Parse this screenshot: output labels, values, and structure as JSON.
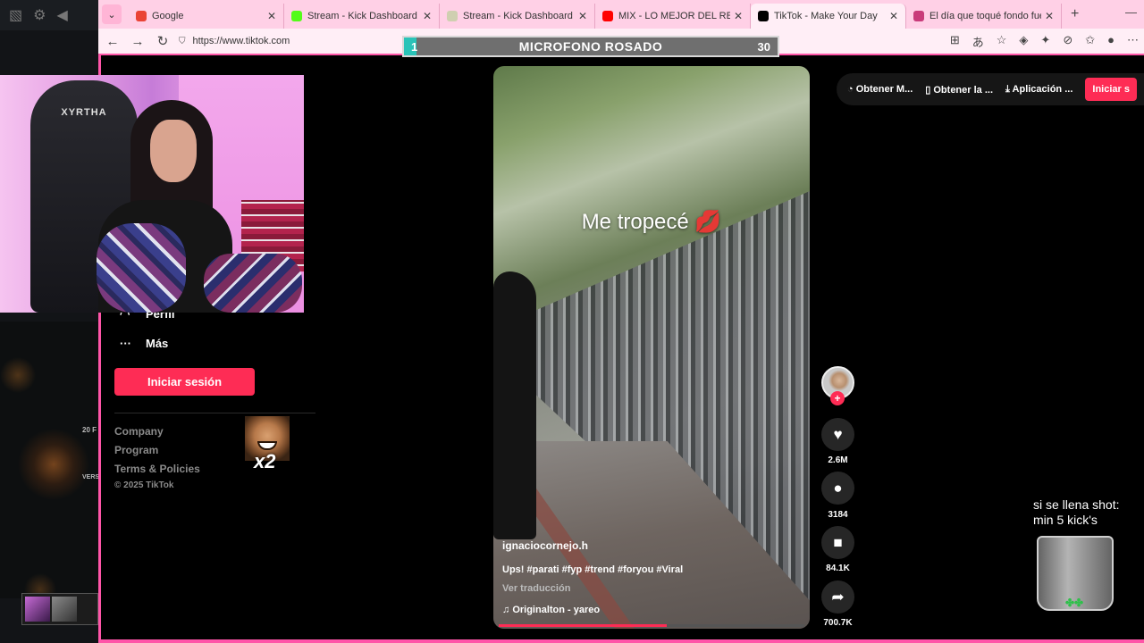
{
  "browser": {
    "tabs": [
      {
        "title": "Google",
        "favicon_color": "#ea4335",
        "active": false
      },
      {
        "title": "Stream - Kick Dashboard",
        "favicon_color": "#53fc18",
        "active": false
      },
      {
        "title": "Stream - Kick Dashboard",
        "favicon_color": "#cfcfb0",
        "active": false
      },
      {
        "title": "MIX - LO MEJOR DEL REGG",
        "favicon_color": "#ff0000",
        "active": false
      },
      {
        "title": "TikTok - Make Your Day",
        "favicon_color": "#000000",
        "active": true
      },
      {
        "title": "El día que toqué fondo fue el d",
        "favicon_color": "#c93b7a",
        "active": false
      }
    ],
    "url": "https://www.tiktok.com"
  },
  "goal_bar": {
    "left_number": "1",
    "label": "MICROFONO ROSADO",
    "right_number": "30",
    "progress_fraction": 0.033
  },
  "sidebar": {
    "profile_label": "Perfil",
    "more_label": "Más",
    "login_button": "Iniciar sesión",
    "footer": [
      "Company",
      "Program",
      "Terms & Policies"
    ],
    "copyright": "© 2025 TikTok"
  },
  "meme_badge": "x2",
  "top_actions": {
    "item1": "Obtener M...",
    "item2": "Obtener la ...",
    "item3": "Aplicación ...",
    "login": "Iniciar s"
  },
  "video": {
    "overlay_text": "Me tropecé 💋",
    "username": "ignaciocornejo.h",
    "caption": "Ups! #parati #fyp #trend #foryou #Viral",
    "translate": "Ver traducción",
    "music": "Originalton - yareo",
    "progress_fraction": 0.55
  },
  "actions": {
    "likes": "2.6M",
    "comments": "3184",
    "saves": "84.1K",
    "shares": "700.7K"
  },
  "webcam": {
    "chair_brand": "XYRTHA"
  },
  "left_panel": {
    "label1": "20 F",
    "label2": "VERS"
  },
  "glass": {
    "text_line1": "si se llena shot:",
    "text_line2": "min 5 kick's"
  },
  "colors": {
    "tiktok_red": "#fe2c55",
    "browser_pink": "#ff55a8",
    "goal_fill": "#2ac3b8"
  }
}
